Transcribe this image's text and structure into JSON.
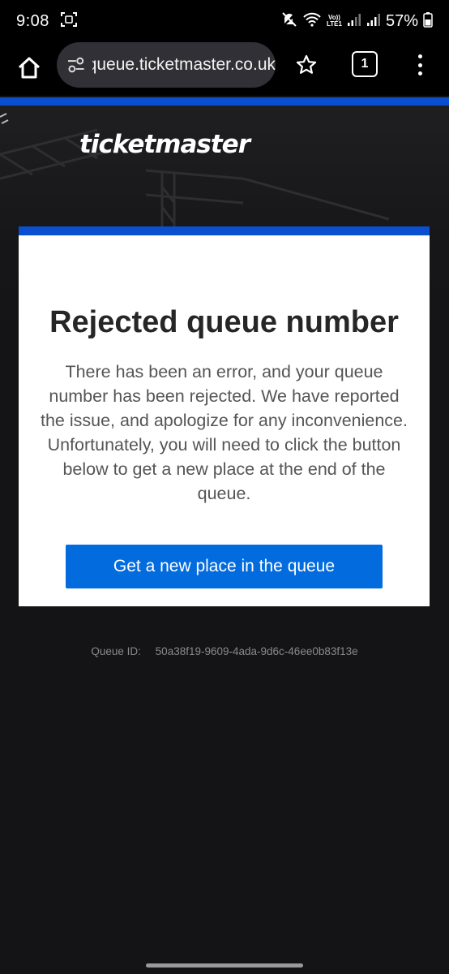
{
  "status_bar": {
    "time": "9:08",
    "volte_top": "Vo))",
    "volte_bottom": "LTE1",
    "battery": "57%",
    "icons": [
      "screenshot-icon",
      "mute-icon",
      "wifi-icon",
      "signal-icon",
      "battery-icon"
    ]
  },
  "browser": {
    "url": "queue.ticketmaster.co.uk",
    "tab_count": "1"
  },
  "page": {
    "logo": "ticketmaster",
    "title": "Rejected queue number",
    "message": "There has been an error, and your queue number has been rejected. We have reported the issue, and apologize for any inconvenience. Unfortunately, you will need to click the button below to get a new place at the end of the queue.",
    "button_label": "Get a new place in the queue",
    "queue_id_label": "Queue ID:",
    "queue_id_value": "50a38f19-9609-4ada-9d6c-46ee0b83f13e"
  },
  "colors": {
    "brand_blue": "#026cdf",
    "stripe_blue": "#0a4fcf",
    "background": "#141416"
  }
}
